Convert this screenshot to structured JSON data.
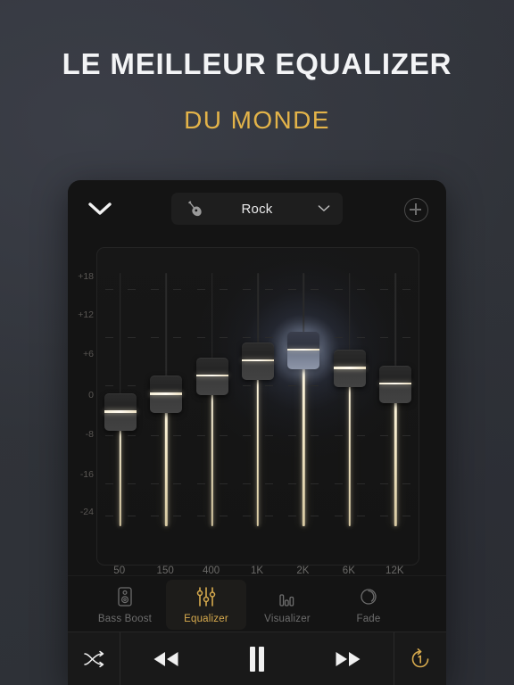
{
  "promo": {
    "headline": "LE MEILLEUR EQUALIZER",
    "subhead": "DU MONDE",
    "headline_color": "#f3f4f6",
    "subhead_color": "#e3b349",
    "background_color": "#31343c"
  },
  "app": {
    "accent_color": "#d8ab4e",
    "panel_color": "#141414",
    "header": {
      "back_icon": "chevron-down-icon",
      "add_icon": "plus-icon",
      "preset": {
        "icon": "guitar-icon",
        "value": "Rock",
        "chevron_icon": "chevron-down-icon"
      }
    },
    "equalizer": {
      "db_labels": [
        "+18",
        "+12",
        "+6",
        "0",
        "-8",
        "-16",
        "-24"
      ],
      "bands": [
        {
          "freq": "50",
          "value_db": -6.0
        },
        {
          "freq": "150",
          "value_db": -2.5
        },
        {
          "freq": "400",
          "value_db": 1.0
        },
        {
          "freq": "1K",
          "value_db": 4.0
        },
        {
          "freq": "2K",
          "value_db": 6.0
        },
        {
          "freq": "6K",
          "value_db": 2.5
        },
        {
          "freq": "12K",
          "value_db": -0.5
        }
      ],
      "highlighted_band_index": 4
    },
    "tabs": [
      {
        "label": "Bass Boost",
        "icon": "speaker-icon",
        "active": false
      },
      {
        "label": "Equalizer",
        "icon": "sliders-icon",
        "active": true
      },
      {
        "label": "Visualizer",
        "icon": "bars-icon",
        "active": false
      },
      {
        "label": "Fade",
        "icon": "fade-circle-icon",
        "active": false
      }
    ],
    "transport": [
      {
        "name": "shuffle-button",
        "icon": "shuffle-icon",
        "active": false
      },
      {
        "name": "previous-button",
        "icon": "rewind-icon",
        "active": false
      },
      {
        "name": "play-pause-button",
        "icon": "pause-icon",
        "active": false
      },
      {
        "name": "next-button",
        "icon": "fast-forward-icon",
        "active": false
      },
      {
        "name": "repeat-one-button",
        "icon": "repeat-one-icon",
        "active": true
      }
    ]
  }
}
